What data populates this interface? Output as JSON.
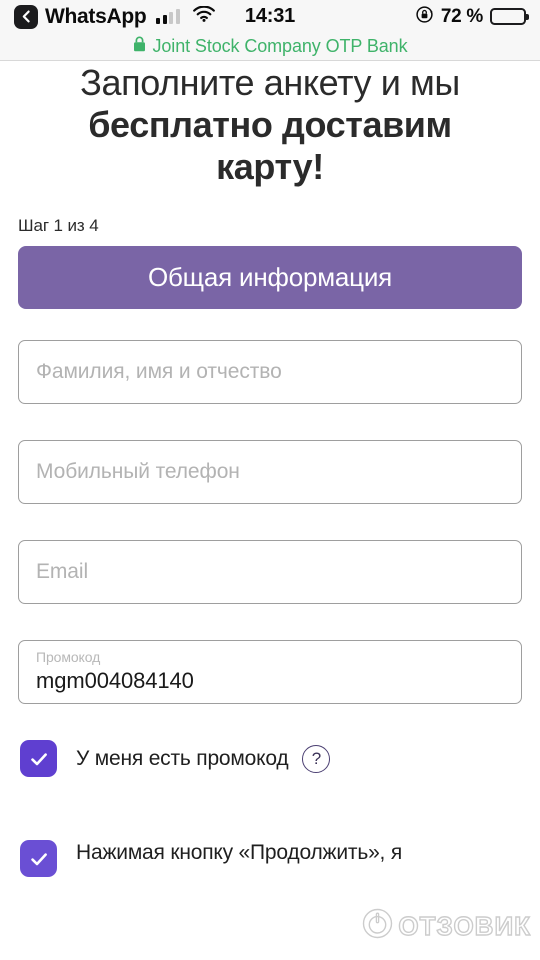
{
  "statusbar": {
    "back_app_label": "WhatsApp",
    "back_icon": "chevron-left-icon",
    "signal_icon": "cellular-signal-icon",
    "wifi_icon": "wifi-icon",
    "time": "14:31",
    "rotation_lock_icon": "rotation-lock-icon",
    "battery_percent": "72 %",
    "battery_icon": "battery-icon"
  },
  "sitebar": {
    "lock_icon": "lock-icon",
    "site_name": "Joint Stock Company OTP Bank",
    "accent_color": "#3fb36a"
  },
  "headline": {
    "line1": "Заполните анкету и мы",
    "line2": "бесплатно доставим",
    "line3": "карту!"
  },
  "form": {
    "step_text": "Шаг 1 из 4",
    "section_title": "Общая информация",
    "section_color": "#7a65a6",
    "fields": [
      {
        "name": "fullname",
        "placeholder": "Фамилия, имя и отчество",
        "value": ""
      },
      {
        "name": "phone",
        "placeholder": "Мобильный телефон",
        "value": ""
      },
      {
        "name": "email",
        "placeholder": "Email",
        "value": ""
      }
    ],
    "promocode": {
      "label": "Промокод",
      "value": "mgm004084140"
    },
    "checkboxes": [
      {
        "name": "have-promocode",
        "label": "У меня есть промокод",
        "checked": true,
        "help_icon": "question-mark-icon",
        "color": "#5f3fd0"
      },
      {
        "name": "accept-terms",
        "label": "Нажимая кнопку «Продолжить», я",
        "checked": true,
        "color": "#6a4fd4"
      }
    ]
  },
  "watermark": {
    "text": "ОТЗОВИК",
    "logo_icon": "otzovik-power-logo-icon"
  }
}
